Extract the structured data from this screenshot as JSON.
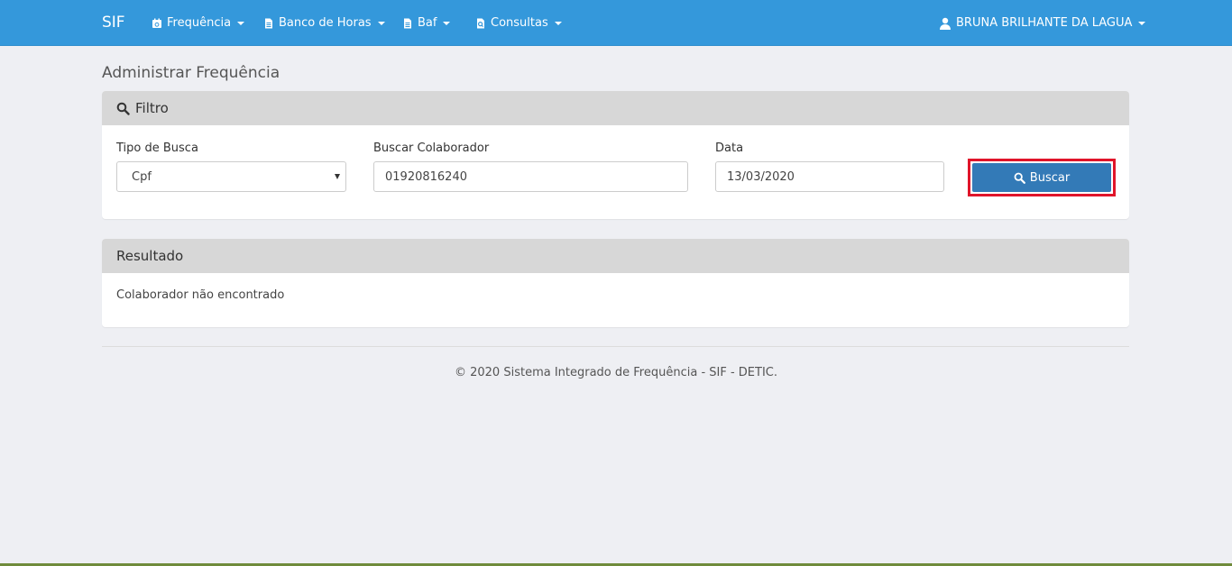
{
  "navbar": {
    "brand": "SIF",
    "items": [
      {
        "label": "Frequência",
        "icon": "calendar-check-icon"
      },
      {
        "label": "Banco de Horas",
        "icon": "file-icon"
      },
      {
        "label": "Baf",
        "icon": "file-icon"
      },
      {
        "label": "Consultas",
        "icon": "file-search-icon"
      }
    ],
    "user": {
      "label": "BRUNA BRILHANTE DA LAGUA",
      "icon": "user-icon"
    }
  },
  "page": {
    "title": "Administrar Frequência"
  },
  "filter": {
    "heading": "Filtro",
    "tipo_busca": {
      "label": "Tipo de Busca",
      "value": "Cpf"
    },
    "colaborador": {
      "label": "Buscar Colaborador",
      "value": "01920816240"
    },
    "data": {
      "label": "Data",
      "value": "13/03/2020"
    },
    "search_button": "Buscar"
  },
  "result": {
    "heading": "Resultado",
    "message": "Colaborador não encontrado"
  },
  "footer": {
    "text": "© 2020 Sistema Integrado de Frequência - SIF - DETIC."
  },
  "colors": {
    "navbar": "#3498db",
    "primary_button": "#337ab7",
    "highlight_border": "#e0152a"
  }
}
